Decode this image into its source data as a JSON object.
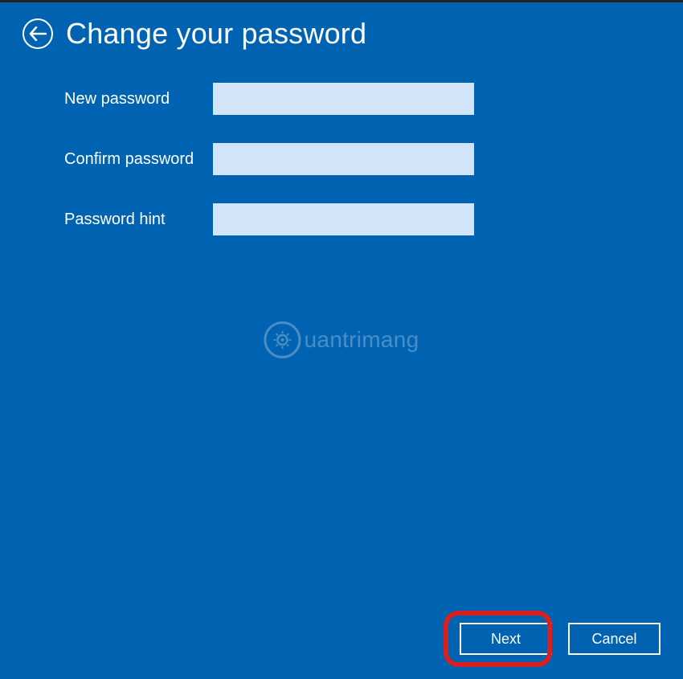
{
  "header": {
    "title": "Change your password"
  },
  "form": {
    "fields": [
      {
        "label": "New password",
        "value": ""
      },
      {
        "label": "Confirm password",
        "value": ""
      },
      {
        "label": "Password hint",
        "value": ""
      }
    ]
  },
  "watermark": {
    "text": "uantrimang"
  },
  "footer": {
    "next_label": "Next",
    "cancel_label": "Cancel"
  }
}
